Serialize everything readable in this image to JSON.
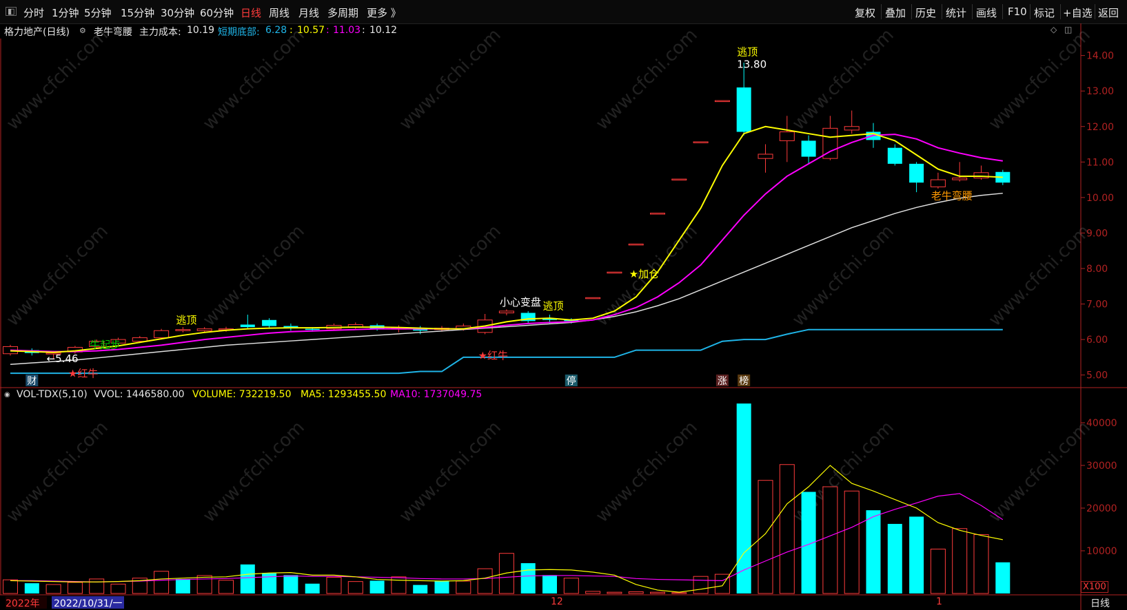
{
  "toolbar": {
    "periods": [
      "分时",
      "1分钟",
      "5分钟",
      "15分钟",
      "30分钟",
      "60分钟",
      "日线",
      "周线",
      "月线",
      "多周期",
      "更多 》"
    ],
    "active_period": "日线",
    "right_buttons": [
      "复权",
      "叠加",
      "历史",
      "统计",
      "画线",
      "F10",
      "标记",
      "+自选",
      "返回"
    ]
  },
  "info": {
    "stock": "格力地产(日线)",
    "indicator": "老牛弯腰",
    "cost_label": "主力成本:",
    "cost_value": "10.19",
    "bottom_label": "短期底部:",
    "bottom_value": "6.28",
    "v1": "10.57",
    "v2": "11.03",
    "v3": "10.12"
  },
  "volinfo": {
    "name": "VOL-TDX(5,10)",
    "vvol": "VVOL: 1446580.00",
    "volume": "VOLUME: 732219.50",
    "ma5": "MA5: 1293455.50",
    "ma10": "MA10: 1737049.75"
  },
  "bottom": {
    "year": "2022年",
    "date": "2022/10/31/一",
    "m12": "12",
    "m1": "1",
    "period": "日线",
    "x100": "X100"
  },
  "colors": {
    "up": "#ff3b3b",
    "down": "#00ffff",
    "ma_yellow": "#ffff00",
    "ma_magenta": "#ff00ff",
    "ma_white": "#e0e0e0",
    "support": "#1fb5e8",
    "axis": "#b22222"
  },
  "chart_data": [
    {
      "type": "candlestick",
      "y_ticks": [
        "14.00",
        "13.00",
        "12.00",
        "11.00",
        "10.00",
        "9.00",
        "8.00",
        "7.00",
        "6.00",
        "5.00"
      ],
      "ylim": [
        4.8,
        14.4
      ],
      "candles": [
        {
          "o": 5.6,
          "c": 5.8,
          "h": 5.85,
          "l": 5.55
        },
        {
          "o": 5.7,
          "c": 5.62,
          "h": 5.75,
          "l": 5.55
        },
        {
          "o": 5.6,
          "c": 5.62,
          "h": 5.68,
          "l": 5.46
        },
        {
          "o": 5.65,
          "c": 5.78,
          "h": 5.82,
          "l": 5.6
        },
        {
          "o": 5.8,
          "c": 5.95,
          "h": 6.0,
          "l": 5.75
        },
        {
          "o": 5.9,
          "c": 6.0,
          "h": 6.05,
          "l": 5.85
        },
        {
          "o": 5.95,
          "c": 6.05,
          "h": 6.1,
          "l": 5.9
        },
        {
          "o": 6.05,
          "c": 6.25,
          "h": 6.3,
          "l": 6.0
        },
        {
          "o": 6.25,
          "c": 6.28,
          "h": 6.35,
          "l": 6.2
        },
        {
          "o": 6.25,
          "c": 6.3,
          "h": 6.35,
          "l": 6.2
        },
        {
          "o": 6.28,
          "c": 6.3,
          "h": 6.36,
          "l": 6.22
        },
        {
          "o": 6.42,
          "c": 6.35,
          "h": 6.7,
          "l": 6.3
        },
        {
          "o": 6.55,
          "c": 6.38,
          "h": 6.6,
          "l": 6.3
        },
        {
          "o": 6.38,
          "c": 6.32,
          "h": 6.45,
          "l": 6.25
        },
        {
          "o": 6.3,
          "c": 6.28,
          "h": 6.35,
          "l": 6.22
        },
        {
          "o": 6.3,
          "c": 6.4,
          "h": 6.45,
          "l": 6.25
        },
        {
          "o": 6.35,
          "c": 6.42,
          "h": 6.48,
          "l": 6.3
        },
        {
          "o": 6.4,
          "c": 6.3,
          "h": 6.45,
          "l": 6.25
        },
        {
          "o": 6.3,
          "c": 6.32,
          "h": 6.4,
          "l": 6.2
        },
        {
          "o": 6.32,
          "c": 6.25,
          "h": 6.38,
          "l": 6.15
        },
        {
          "o": 6.28,
          "c": 6.32,
          "h": 6.38,
          "l": 6.22
        },
        {
          "o": 6.3,
          "c": 6.38,
          "h": 6.45,
          "l": 6.25
        },
        {
          "o": 6.2,
          "c": 6.55,
          "h": 6.72,
          "l": 6.15
        },
        {
          "o": 6.75,
          "c": 6.8,
          "h": 6.85,
          "l": 6.68
        },
        {
          "o": 6.75,
          "c": 6.52,
          "h": 6.8,
          "l": 6.45
        },
        {
          "o": 6.6,
          "c": 6.55,
          "h": 6.7,
          "l": 6.45
        },
        {
          "o": 6.55,
          "c": 6.52,
          "h": 6.6,
          "l": 6.45
        },
        {
          "o": 7.18,
          "c": 7.18,
          "h": 7.18,
          "l": 7.18
        },
        {
          "o": 7.9,
          "c": 7.9,
          "h": 7.9,
          "l": 7.9
        },
        {
          "o": 8.69,
          "c": 8.69,
          "h": 8.69,
          "l": 8.69
        },
        {
          "o": 9.56,
          "c": 9.56,
          "h": 9.56,
          "l": 9.56
        },
        {
          "o": 10.52,
          "c": 10.52,
          "h": 10.52,
          "l": 10.52
        },
        {
          "o": 11.57,
          "c": 11.57,
          "h": 11.57,
          "l": 11.57
        },
        {
          "o": 12.73,
          "c": 12.73,
          "h": 12.73,
          "l": 12.73
        },
        {
          "o": 13.1,
          "c": 11.85,
          "h": 13.8,
          "l": 11.75
        },
        {
          "o": 11.1,
          "c": 11.22,
          "h": 11.5,
          "l": 10.7
        },
        {
          "o": 11.6,
          "c": 11.85,
          "h": 12.3,
          "l": 11.0
        },
        {
          "o": 11.6,
          "c": 11.15,
          "h": 11.75,
          "l": 10.95
        },
        {
          "o": 11.1,
          "c": 11.95,
          "h": 12.3,
          "l": 11.05
        },
        {
          "o": 11.9,
          "c": 12.0,
          "h": 12.45,
          "l": 11.8
        },
        {
          "o": 11.85,
          "c": 11.62,
          "h": 12.1,
          "l": 11.4
        },
        {
          "o": 11.4,
          "c": 10.95,
          "h": 11.5,
          "l": 10.9
        },
        {
          "o": 10.95,
          "c": 10.42,
          "h": 11.0,
          "l": 10.15
        },
        {
          "o": 10.3,
          "c": 10.5,
          "h": 10.7,
          "l": 10.25
        },
        {
          "o": 10.5,
          "c": 10.55,
          "h": 11.0,
          "l": 10.45
        },
        {
          "o": 10.55,
          "c": 10.7,
          "h": 10.9,
          "l": 10.5
        },
        {
          "o": 10.72,
          "c": 10.42,
          "h": 10.78,
          "l": 10.35
        }
      ],
      "ma_yellow": [
        5.68,
        5.66,
        5.64,
        5.68,
        5.75,
        5.82,
        5.92,
        6.02,
        6.12,
        6.2,
        6.26,
        6.3,
        6.32,
        6.33,
        6.33,
        6.34,
        6.35,
        6.35,
        6.34,
        6.32,
        6.3,
        6.3,
        6.38,
        6.5,
        6.58,
        6.6,
        6.55,
        6.6,
        6.8,
        7.2,
        7.9,
        8.8,
        9.7,
        10.9,
        11.8,
        12.0,
        11.9,
        11.8,
        11.7,
        11.75,
        11.8,
        11.6,
        11.2,
        10.8,
        10.6,
        10.6,
        10.57
      ],
      "ma_magenta": [
        5.7,
        5.68,
        5.66,
        5.66,
        5.68,
        5.72,
        5.78,
        5.84,
        5.92,
        6.0,
        6.06,
        6.12,
        6.18,
        6.22,
        6.24,
        6.26,
        6.28,
        6.3,
        6.3,
        6.3,
        6.3,
        6.3,
        6.34,
        6.4,
        6.45,
        6.48,
        6.5,
        6.55,
        6.7,
        6.9,
        7.2,
        7.6,
        8.1,
        8.8,
        9.5,
        10.1,
        10.6,
        10.95,
        11.3,
        11.55,
        11.75,
        11.78,
        11.65,
        11.4,
        11.25,
        11.12,
        11.03
      ],
      "ma_white": [
        5.3,
        5.34,
        5.38,
        5.42,
        5.48,
        5.54,
        5.6,
        5.66,
        5.72,
        5.78,
        5.84,
        5.88,
        5.92,
        5.96,
        6.0,
        6.04,
        6.08,
        6.12,
        6.16,
        6.2,
        6.24,
        6.28,
        6.32,
        6.36,
        6.4,
        6.44,
        6.48,
        6.55,
        6.65,
        6.78,
        6.95,
        7.15,
        7.4,
        7.65,
        7.9,
        8.15,
        8.4,
        8.65,
        8.9,
        9.15,
        9.35,
        9.55,
        9.72,
        9.86,
        9.98,
        10.06,
        10.12
      ],
      "support": [
        5.05,
        5.05,
        5.05,
        5.05,
        5.05,
        5.05,
        5.05,
        5.05,
        5.05,
        5.05,
        5.05,
        5.05,
        5.05,
        5.05,
        5.05,
        5.05,
        5.05,
        5.05,
        5.05,
        5.1,
        5.1,
        5.5,
        5.5,
        5.5,
        5.5,
        5.5,
        5.5,
        5.5,
        5.5,
        5.7,
        5.7,
        5.7,
        5.7,
        5.95,
        6.0,
        6.0,
        6.15,
        6.28,
        6.28,
        6.28,
        6.28,
        6.28,
        6.28,
        6.28,
        6.28,
        6.28,
        6.28
      ],
      "annotations": [
        {
          "text": "逃顶",
          "i": 8,
          "y": 6.45,
          "color": "#ffff00"
        },
        {
          "text": "小心变盘",
          "i": 23,
          "y": 6.95,
          "color": "#ffffff"
        },
        {
          "text": "逃顶",
          "i": 25,
          "y": 6.85,
          "color": "#ffff00"
        },
        {
          "text": "★加仓",
          "i": 29,
          "y": 7.75,
          "color": "#ffff00"
        },
        {
          "text": "逃顶",
          "i": 34,
          "y": 14.0,
          "color": "#ffff00"
        },
        {
          "text": "13.80",
          "i": 34,
          "y": 13.65,
          "color": "#ffffff"
        },
        {
          "text": "老牛弯腰",
          "i": 43,
          "y": 9.95,
          "color": "#ff9900"
        },
        {
          "text": "←5.46",
          "i": 2,
          "y": 5.36,
          "color": "#ffffff"
        },
        {
          "text": "牛起步",
          "i": 4,
          "y": 5.75,
          "color": "#00cc00"
        },
        {
          "text": "★红牛",
          "i": 3,
          "y": 4.95,
          "color": "#ff3b3b"
        },
        {
          "text": "★红牛",
          "i": 22,
          "y": 5.45,
          "color": "#ff3b3b"
        }
      ],
      "tags": [
        {
          "text": "财",
          "i": 1,
          "bg": "#1a4a6a"
        },
        {
          "text": "停",
          "i": 26,
          "bg": "#1a5a6a"
        },
        {
          "text": "涨",
          "i": 33,
          "bg": "#5a2020"
        },
        {
          "text": "榜",
          "i": 34,
          "bg": "#5a3a10"
        }
      ]
    },
    {
      "type": "bar",
      "y_ticks": [
        "40000",
        "30000",
        "20000",
        "10000"
      ],
      "ylim": [
        0,
        45000
      ],
      "volumes": [
        3200,
        2400,
        2100,
        2600,
        3400,
        2200,
        3600,
        5200,
        3400,
        4200,
        3100,
        6800,
        4800,
        4300,
        2300,
        3800,
        2800,
        3000,
        3900,
        2000,
        3000,
        2900,
        5800,
        9400,
        7100,
        4300,
        3600,
        500,
        300,
        400,
        300,
        200,
        4000,
        4500,
        44500,
        26500,
        30200,
        23800,
        25000,
        24000,
        19500,
        16300,
        18000,
        10400,
        15200,
        13800,
        7300
      ],
      "up_flags": [
        1,
        0,
        1,
        1,
        1,
        1,
        1,
        1,
        0,
        1,
        1,
        0,
        0,
        0,
        0,
        1,
        1,
        0,
        1,
        0,
        0,
        1,
        1,
        1,
        0,
        0,
        1,
        1,
        1,
        1,
        1,
        1,
        1,
        1,
        0,
        1,
        1,
        0,
        1,
        1,
        0,
        0,
        0,
        1,
        1,
        1,
        0
      ],
      "ma5": [
        3000,
        2900,
        2800,
        2700,
        2700,
        2800,
        3000,
        3400,
        3600,
        3800,
        3900,
        4500,
        4800,
        4900,
        4300,
        4300,
        3900,
        3300,
        3100,
        3000,
        2900,
        3000,
        3600,
        4800,
        5500,
        5600,
        5500,
        5000,
        4300,
        2100,
        800,
        300,
        1000,
        1800,
        9500,
        14000,
        21000,
        25000,
        30000,
        25800,
        24000,
        22000,
        20000,
        16600,
        14800,
        13600,
        12600
      ],
      "ma10": [
        3000,
        3000,
        2900,
        2800,
        2700,
        2800,
        2900,
        3100,
        3300,
        3400,
        3500,
        3700,
        3900,
        4100,
        4000,
        4000,
        3900,
        3800,
        3700,
        3500,
        3400,
        3400,
        3500,
        3800,
        4100,
        4200,
        4200,
        4100,
        4000,
        3500,
        3300,
        3200,
        3100,
        3000,
        5500,
        7600,
        9700,
        11500,
        13500,
        15500,
        18000,
        19700,
        21200,
        22800,
        23400,
        20600,
        17300
      ]
    }
  ]
}
